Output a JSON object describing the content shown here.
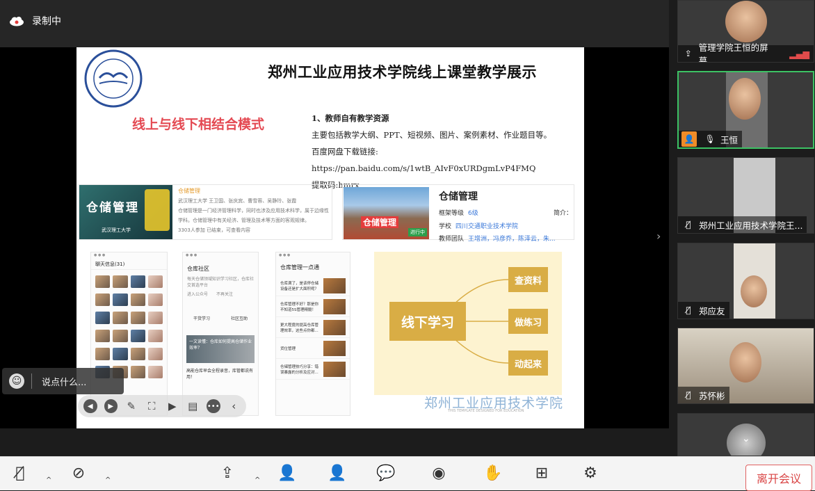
{
  "window": {
    "recording_label": "录制中"
  },
  "slide": {
    "title": "郑州工业应用技术学院线上课堂教学展示",
    "red_heading": "线上与线下相结合模式",
    "resources": {
      "heading": "1、教师自有教学资源",
      "line1": "主要包括教学大纲、PPT、短视频、图片、案例素材、作业题目等。",
      "line2": "百度网盘下载链接: https://pan.baidu.com/s/1wtB_AIvF0xURDgmLvP4FMQ",
      "line3": "提取码:hmrx"
    },
    "course1": {
      "image_text": "仓储管理",
      "image_sub": "武汉理工大学",
      "title": "仓储管理",
      "authors": "武汉理工大学 王卫国、张庆宾、曹雪蓉、吴静玲、张霞",
      "desc": "仓储管理是一门经济管理科学，同时也涉及应用技术科学，属于边缘性学科。仓储管理中有关经济、管理及技术等方面的客观规律。",
      "meta": "3303人参加   已结束，可查看内容"
    },
    "course2": {
      "image_text": "仓储管理",
      "image_sub": "进行中",
      "title": "仓储管理",
      "level_label": "框架等级",
      "level_value": "6级",
      "intro_label": "简介：",
      "school_label": "学校",
      "school_value": "四川交通职业技术学院",
      "team_label": "教师团队",
      "team_value": "王增洲，冯彦乔，陈泽云，朱..."
    },
    "phone1": {
      "header": "聊天信息(31)"
    },
    "phone2": {
      "title": "仓库社区",
      "desc": "每天仓储领域知识学习社区，仓库社交首选平台",
      "follow": "进入公众号",
      "unfollow": "不再关注",
      "tab1": "干货学习",
      "tab2": "社区互助",
      "banner": "一文读懂：仓库如何提高仓储作业效率？",
      "item": "高能仓库早会全程录音，库管都说有用！"
    },
    "phone3": {
      "title": "仓库管理一点通",
      "rows": [
        "仓库满了，是该停仓储设备还是扩大面积呢？",
        "仓库管理不好？那是你不知道5S管理精髓！",
        "更大程度的提高仓库管理效率，这些点你都...",
        "货位管理",
        "仓储管理技巧分享：错误暴露的分析及应对..."
      ]
    },
    "mindmap": {
      "center": "线下学习",
      "nodes": [
        "查资料",
        "做练习",
        "动起来"
      ]
    },
    "watermark": "郑州工业应用技术学院",
    "watermark_sub": "THIS TEMPLATE DESIGNED FOR EDUCATION"
  },
  "comment": {
    "placeholder": "说点什么..."
  },
  "participants": [
    {
      "name": "管理学院王恒的屏幕..."
    },
    {
      "name": "王恒"
    },
    {
      "name": "郑州工业应用技术学院王..."
    },
    {
      "name": "郑应友"
    },
    {
      "name": "苏怀彬"
    }
  ],
  "bottom": {
    "leave": "离开会议"
  },
  "colors": {
    "accent_green": "#3cc264",
    "leave_red": "#d94444",
    "mind_gold": "#d9ad45"
  }
}
